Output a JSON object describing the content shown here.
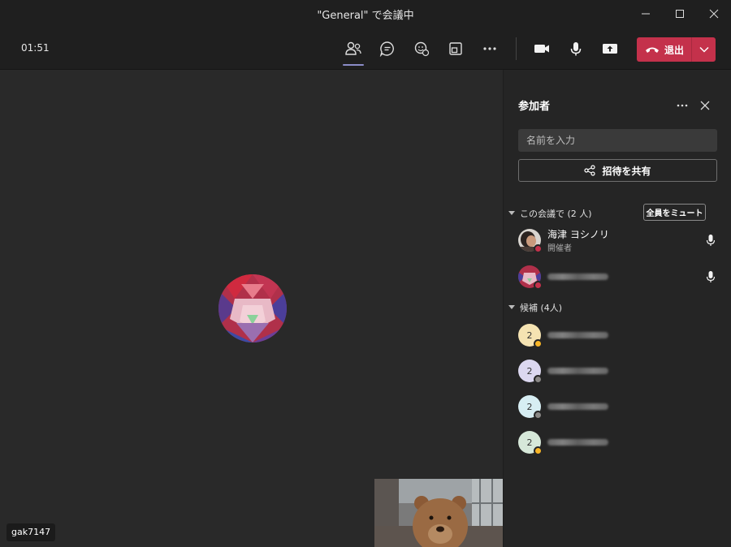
{
  "window": {
    "title": "\"General\" で会議中"
  },
  "toolbar": {
    "timer": "01:51",
    "leave_label": "退出",
    "icons": [
      "participants-icon",
      "chat-icon",
      "reactions-icon",
      "rooms-icon",
      "more-icon",
      "camera-icon",
      "mic-icon",
      "share-screen-icon"
    ]
  },
  "stage": {
    "name_tag": "gak7147"
  },
  "panel": {
    "title": "参加者",
    "search_placeholder": "名前を入力",
    "share_label": "招待を共有",
    "in_meeting": {
      "heading": "この会議で (2 人)",
      "mute_all_label": "全員をミュート",
      "people": [
        {
          "name": "海津 ヨシノリ",
          "role": "開催者"
        }
      ]
    },
    "suggested": {
      "heading": "候補 (4人)",
      "people": [
        {
          "initial": "2",
          "color": "#f5e3b2",
          "presence": "#f8b526"
        },
        {
          "initial": "2",
          "color": "#dcd8f0",
          "presence": "#8a8886"
        },
        {
          "initial": "2",
          "color": "#d7eef3",
          "presence": "#8a8886"
        },
        {
          "initial": "2",
          "color": "#d6e8d9",
          "presence": "#f8b526"
        }
      ]
    }
  },
  "colors": {
    "leave": "#c4314b",
    "accent": "#8b8cc7",
    "busy": "#c4314b"
  }
}
